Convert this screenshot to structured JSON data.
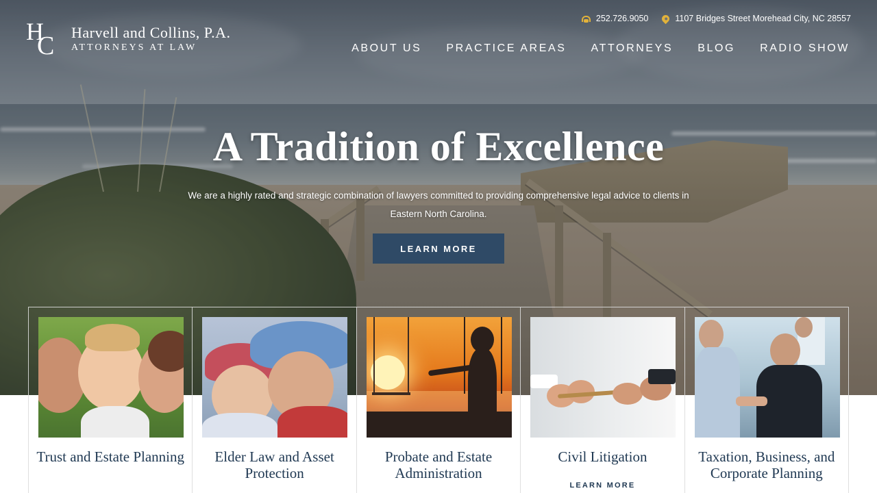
{
  "brand": {
    "firm_name": "Harvell and Collins, P.A.",
    "tagline": "Attorneys at Law",
    "mark_h": "H",
    "mark_c": "C"
  },
  "contact": {
    "phone": "252.726.9050",
    "address": "1107 Bridges Street Morehead City, NC 28557",
    "phone_icon": "phone-icon",
    "address_icon": "map-pin-icon",
    "icon_color": "#e2b23a"
  },
  "nav": {
    "items": [
      "ABOUT US",
      "PRACTICE AREAS",
      "ATTORNEYS",
      "BLOG",
      "RADIO SHOW"
    ]
  },
  "hero": {
    "title": "A Tradition of Excellence",
    "subtitle": "We are a highly rated and strategic combination of lawyers committed to providing comprehensive legal advice to clients in Eastern North Carolina.",
    "button_label": "LEARN MORE",
    "button_color": "#2f4a66"
  },
  "practice_areas": [
    {
      "title": "Trust and Estate Planning",
      "more": ""
    },
    {
      "title": "Elder Law and Asset Protection",
      "more": ""
    },
    {
      "title": "Probate and Estate Administration",
      "more": ""
    },
    {
      "title": "Civil Litigation",
      "more": "LEARN MORE"
    },
    {
      "title": "Taxation, Business, and Corporate Planning",
      "more": ""
    }
  ],
  "colors": {
    "heading_navy": "#1f3852",
    "accent_gold": "#e2b23a"
  }
}
